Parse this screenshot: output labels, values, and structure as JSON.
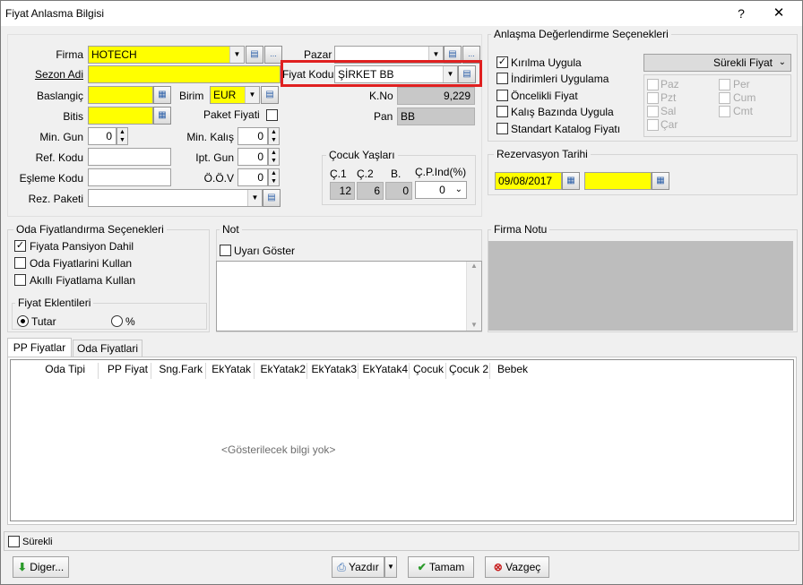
{
  "window": {
    "title": "Fiyat Anlasma Bilgisi",
    "help": "?",
    "close": "✕"
  },
  "form": {
    "firma_label": "Firma",
    "firma_value": "HOTECH",
    "pazar_label": "Pazar",
    "pazar_value": "",
    "sezon_label": "Sezon Adi",
    "sezon_value": "",
    "fiyat_kodu_label": "Fiyat Kodu",
    "fiyat_kodu_value": "ŞİRKET BB",
    "baslangic_label": "Baslangiç",
    "baslangic_value": "",
    "birim_label": "Birim",
    "birim_value": "EUR",
    "kno_label": "K.No",
    "kno_value": "9,229",
    "bitis_label": "Bitis",
    "bitis_value": "",
    "paket_label": "Paket Fiyati",
    "pan_label": "Pan",
    "pan_value": "BB",
    "min_gun_label": "Min. Gun",
    "min_gun_value": "0",
    "min_kalis_label": "Min. Kalış",
    "min_kalis_value": "0",
    "ref_kodu_label": "Ref. Kodu",
    "ref_kodu_value": "",
    "ipt_gun_label": "Ipt. Gun",
    "ipt_gun_value": "0",
    "esleme_label": "Eşleme Kodu",
    "esleme_value": "",
    "oov_label": "Ö.Ö.V",
    "oov_value": "0",
    "rez_paketi_label": "Rez. Paketi",
    "rez_paketi_value": ""
  },
  "cocuk": {
    "title": "Çocuk Yaşları",
    "c1_label": "Ç.1",
    "c2_label": "Ç.2",
    "b_label": "B.",
    "cpind_label": "Ç.P.Ind(%)",
    "c1": "12",
    "c2": "6",
    "b": "0",
    "cpind": "0"
  },
  "anlasma": {
    "title": "Anlaşma Değerlendirme Seçenekleri",
    "options": [
      "Kırılma Uygula",
      "İndirimleri Uygulama",
      "Öncelikli Fiyat",
      "Kalış Bazında Uygula",
      "Standart Katalog Fiyatı"
    ],
    "select": "Sürekli Fiyat",
    "days_left": [
      "Paz",
      "Pzt",
      "Sal",
      "Çar"
    ],
    "days_right": [
      "Per",
      "Cum",
      "Cmt"
    ]
  },
  "rezervasyon": {
    "title": "Rezervasyon Tarihi",
    "date1": "09/08/2017",
    "date2": ""
  },
  "oda": {
    "title": "Oda Fiyatlandırma Seçenekleri",
    "options": [
      "Fiyata Pansiyon Dahil",
      "Oda Fiyatlarini Kullan",
      "Akıllı Fiyatlama Kullan"
    ]
  },
  "eklenti": {
    "title": "Fiyat Eklentileri",
    "tutar": "Tutar",
    "yuzde": "%"
  },
  "not": {
    "title": "Not",
    "uyari": "Uyarı Göster"
  },
  "firma_notu": {
    "title": "Firma Notu"
  },
  "tabs": [
    "PP Fiyatlar",
    "Oda Fiyatlari"
  ],
  "grid": {
    "columns": [
      "Oda Tipi",
      "PP Fiyat",
      "Sng.Fark",
      "EkYatak",
      "EkYatak2",
      "EkYatak3",
      "EkYatak4",
      "Çocuk",
      "Çocuk 2",
      "Bebek"
    ],
    "empty": "<Gösterilecek bilgi yok>"
  },
  "surekli": "Sürekli",
  "buttons": {
    "diger": "Diger...",
    "yazdir": "Yazdır",
    "tamam": "Tamam",
    "vazgec": "Vazgeç"
  },
  "colors": {
    "highlight": "#e02020",
    "required": "#ffff00"
  }
}
